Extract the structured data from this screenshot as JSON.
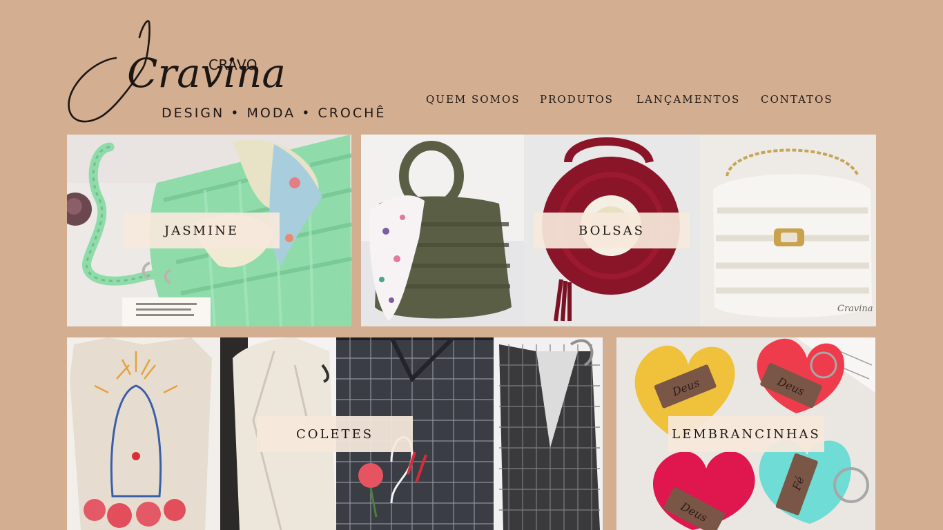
{
  "brand": {
    "script_name": "Cravina",
    "top_word": "CRAVO",
    "tagline": "DESIGN • MODA • CROCHÊ"
  },
  "nav": {
    "items": [
      "QUEM SOMOS",
      "PRODUTOS",
      "LANÇAMENTOS",
      "CONTATOS"
    ]
  },
  "tiles": {
    "jasmine": {
      "label": "JASMINE"
    },
    "bolsas": {
      "label": "BOLSAS"
    },
    "coletes": {
      "label": "COLETES"
    },
    "lembrancinhas": {
      "label": "LEMBRANCINHAS",
      "tag_text": "Deus",
      "tag_text_2": "Fé"
    }
  },
  "photo_signature": "Cravina",
  "colors": {
    "page_background": "#d4ae91",
    "label_background": "#f6e8dc",
    "text": "#1c1714",
    "mint_bag": "#8fdcaa",
    "olive_bag": "#5a5e45",
    "burgundy_bag": "#8a1528",
    "white_bag": "#f1ede6",
    "linen_vest": "#e6ddd0",
    "yellow_heart": "#f0c23c",
    "red_heart": "#ef3c4c",
    "magenta_heart": "#e0164e",
    "turquoise_heart": "#6fdcd6"
  }
}
